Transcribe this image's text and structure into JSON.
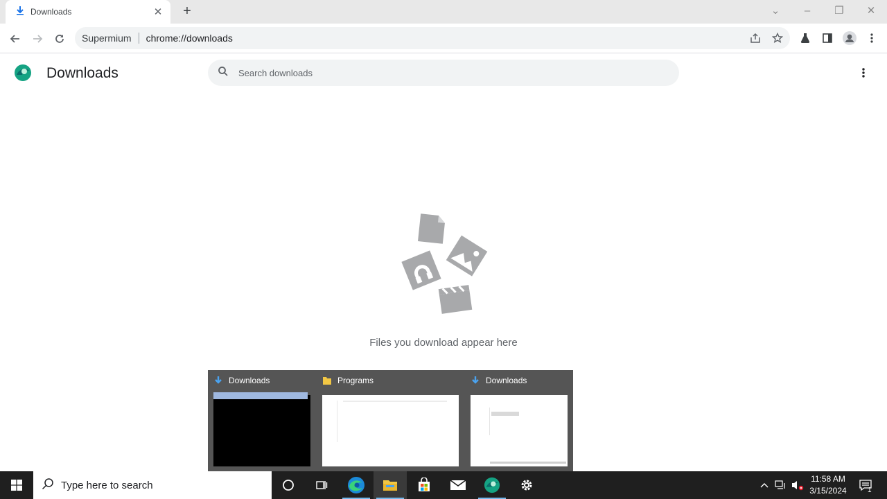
{
  "browser": {
    "tab": {
      "title": "Downloads",
      "icon": "download-icon",
      "close_icon": "close-icon"
    },
    "new_tab_icon": "plus-icon",
    "window_controls": [
      "chevron-down-icon",
      "minimize-icon",
      "restore-icon",
      "close-icon"
    ],
    "address_bar": {
      "chip": "Supermium",
      "url": "chrome://downloads"
    },
    "toolbar_icons": [
      "share-icon",
      "star-icon",
      "labs-flask-icon",
      "side-panel-icon",
      "profile-icon",
      "menu-icon"
    ]
  },
  "page": {
    "title": "Downloads",
    "search": {
      "placeholder": "Search downloads",
      "value": ""
    },
    "empty_message": "Files you download appear here"
  },
  "taskbar_thumbnails": [
    {
      "label": "Downloads",
      "icon": "download-icon"
    },
    {
      "label": "Programs",
      "icon": "folder-icon"
    },
    {
      "label": "Downloads",
      "icon": "download-icon"
    }
  ],
  "taskbar": {
    "search_placeholder": "Type here to search",
    "apps": [
      "cortana-icon",
      "task-view-icon",
      "edge-icon",
      "file-explorer-icon",
      "store-icon",
      "mail-icon",
      "supermium-icon",
      "settings-icon"
    ],
    "clock": {
      "time": "11:58 AM",
      "date": "3/15/2024"
    },
    "notification_count": "1"
  },
  "colors": {
    "accent": "#1a73e8",
    "taskbar": "#1f1f1f",
    "thumb_bg": "#555555"
  }
}
